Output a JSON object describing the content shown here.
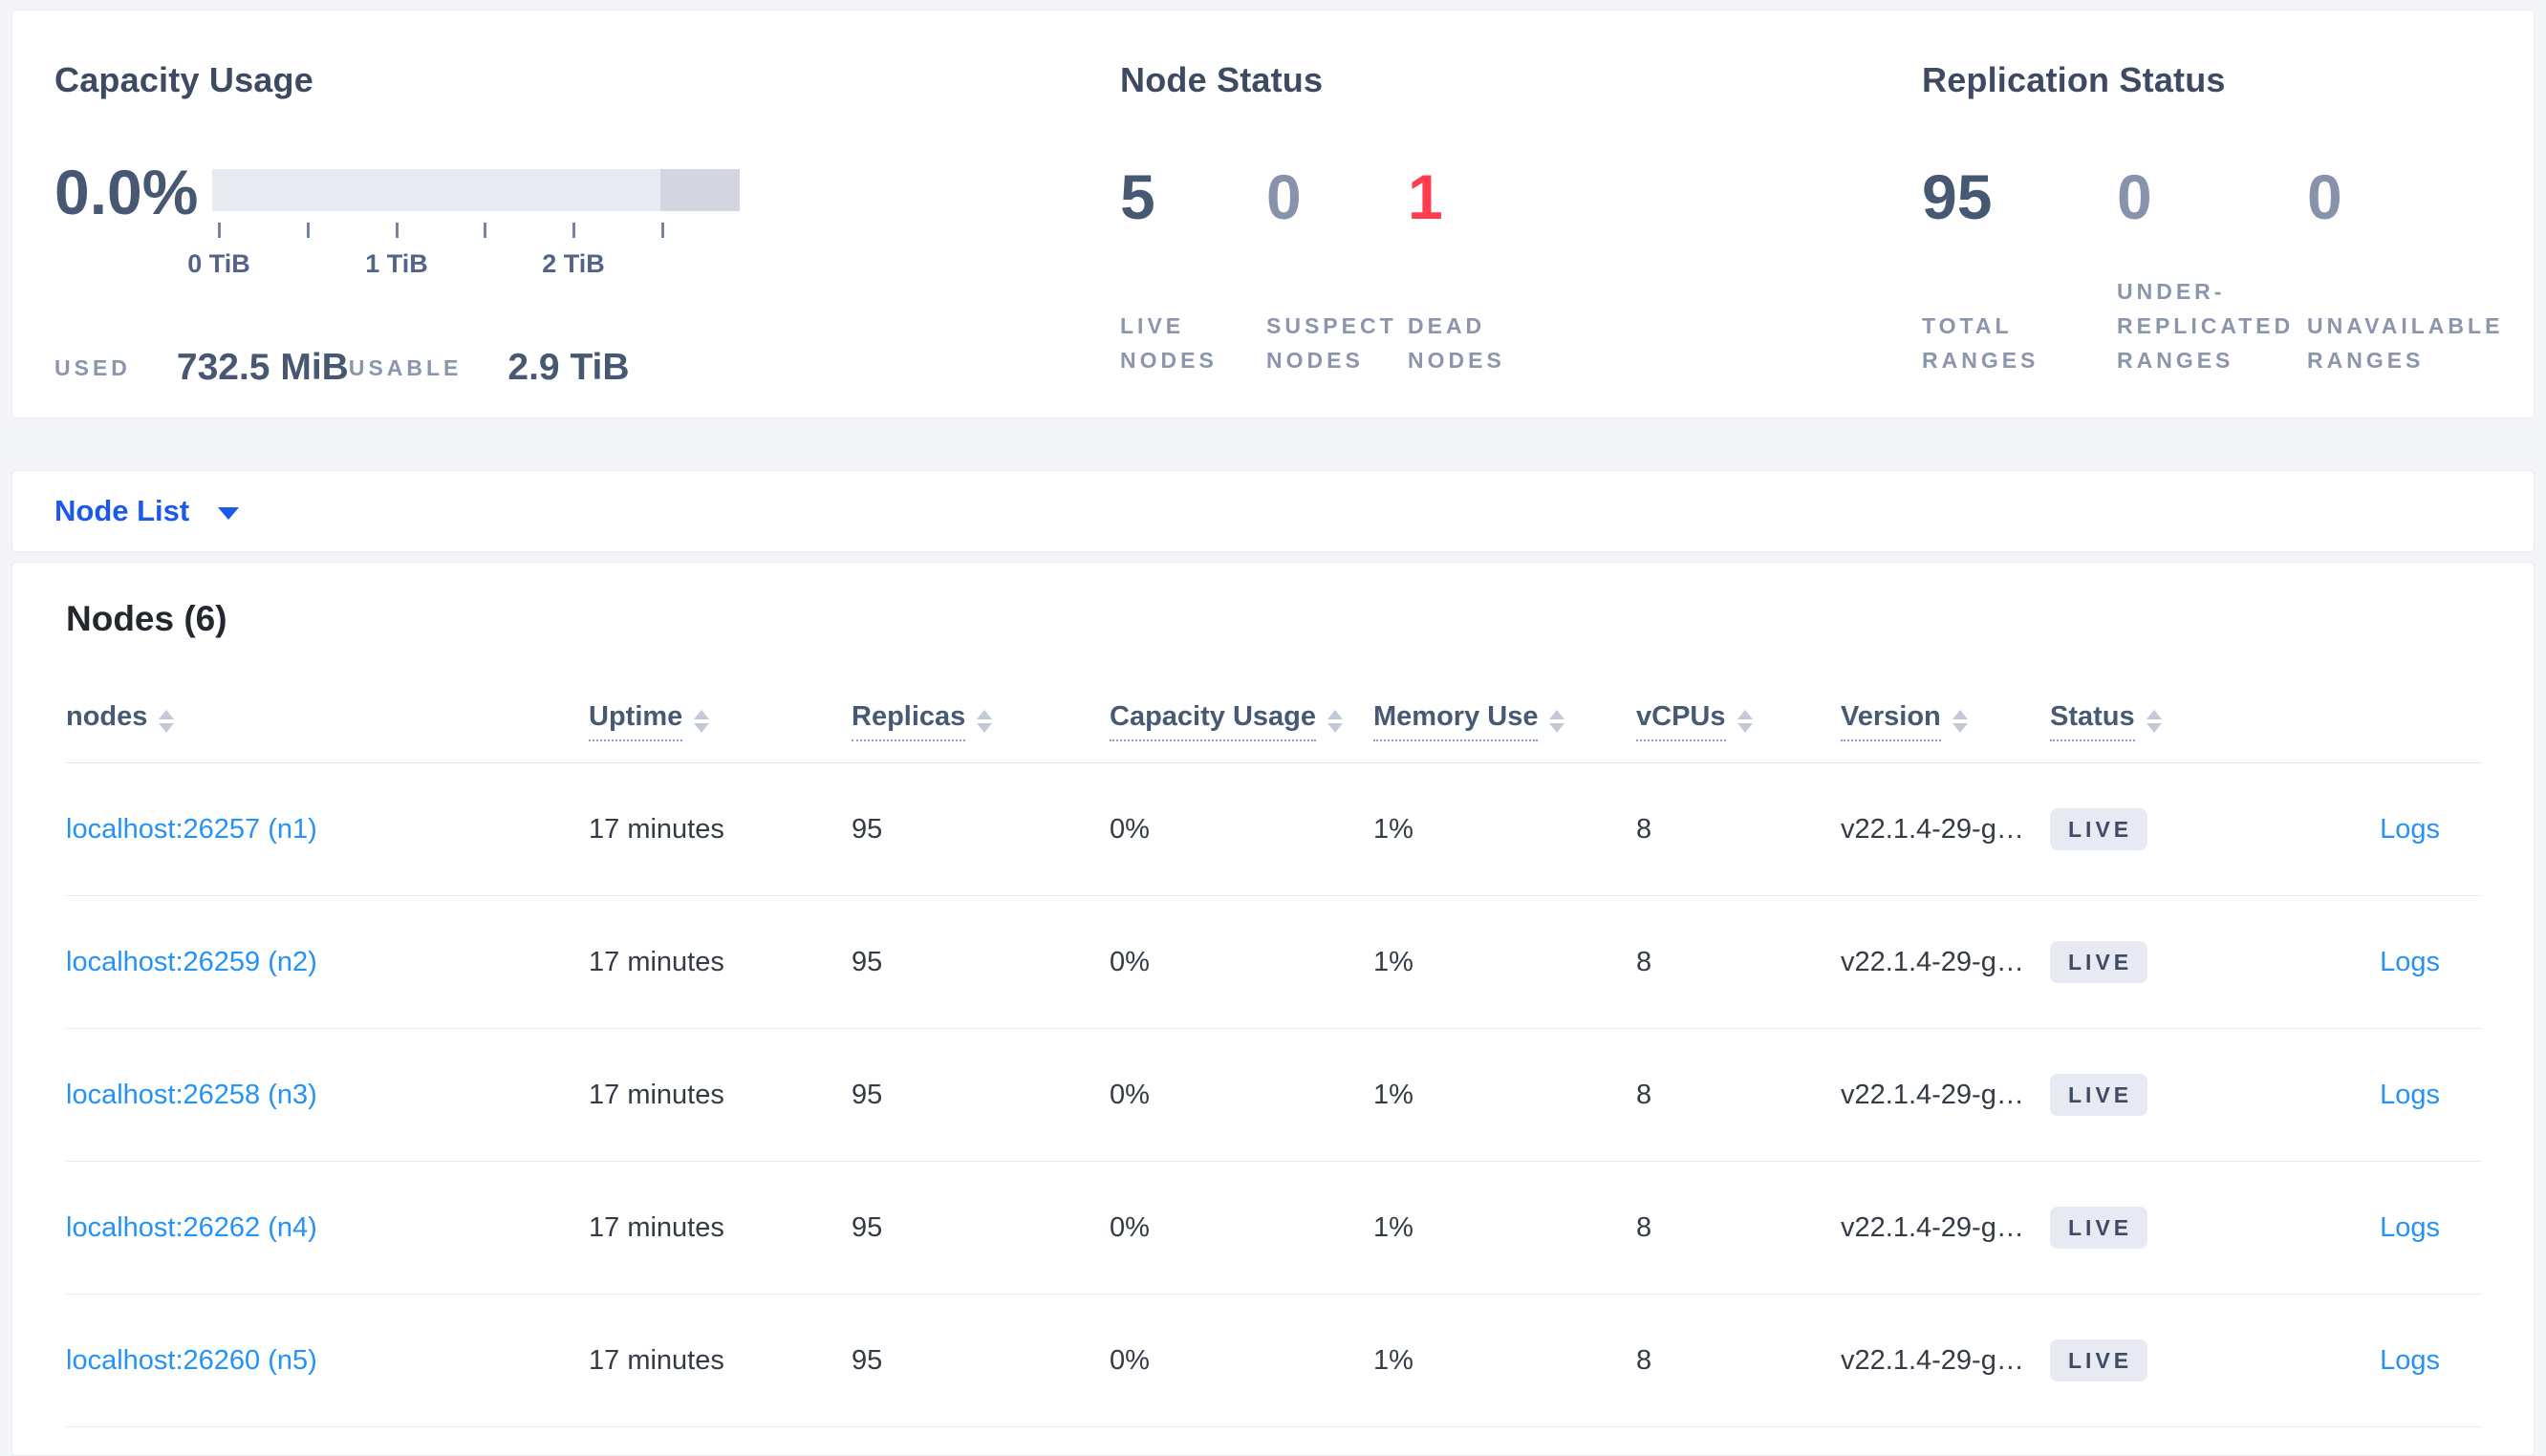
{
  "overview_card": {
    "capacity": {
      "title": "Capacity Usage",
      "percent": "0.0%",
      "bar": {
        "track_color": "#e8eaf1",
        "end_segment_color": "#d3d6e1",
        "end_segment_pct": 15
      },
      "tick_labels": [
        "0 TiB",
        "1 TiB",
        "2 TiB"
      ],
      "used_label": "USED",
      "used_value": "732.5 MiB",
      "usable_label": "USABLE",
      "usable_value": "2.9 TiB"
    },
    "node_status": {
      "title": "Node Status",
      "metrics": [
        {
          "value": "5",
          "label": "LIVE NODES",
          "value_color": "#475872"
        },
        {
          "value": "0",
          "label": "SUSPECT NODES",
          "value_color": "#8792ad"
        },
        {
          "value": "1",
          "label": "DEAD NODES",
          "value_color": "#ff3b4e"
        }
      ]
    },
    "replication_status": {
      "title": "Replication Status",
      "metrics": [
        {
          "value": "95",
          "label": "TOTAL RANGES",
          "value_color": "#475872"
        },
        {
          "value": "0",
          "label": "UNDER-REPLICATED RANGES",
          "value_color": "#8792ad"
        },
        {
          "value": "0",
          "label": "UNAVAILABLE RANGES",
          "value_color": "#8792ad"
        }
      ]
    }
  },
  "view_selector": {
    "label": "Node List"
  },
  "nodes_section": {
    "title": "Nodes (6)",
    "columns": [
      {
        "label": "nodes"
      },
      {
        "label": "Uptime"
      },
      {
        "label": "Replicas"
      },
      {
        "label": "Capacity Usage"
      },
      {
        "label": "Memory Use"
      },
      {
        "label": "vCPUs"
      },
      {
        "label": "Version"
      },
      {
        "label": "Status"
      }
    ],
    "rows": [
      {
        "node": "localhost:26257 (n1)",
        "uptime": "17 minutes",
        "replicas": "95",
        "capacity": "0%",
        "memory": "1%",
        "vcpus": "8",
        "version": "v22.1.4-29-g…",
        "status": "LIVE",
        "logs": "Logs"
      },
      {
        "node": "localhost:26259 (n2)",
        "uptime": "17 minutes",
        "replicas": "95",
        "capacity": "0%",
        "memory": "1%",
        "vcpus": "8",
        "version": "v22.1.4-29-g…",
        "status": "LIVE",
        "logs": "Logs"
      },
      {
        "node": "localhost:26258 (n3)",
        "uptime": "17 minutes",
        "replicas": "95",
        "capacity": "0%",
        "memory": "1%",
        "vcpus": "8",
        "version": "v22.1.4-29-g…",
        "status": "LIVE",
        "logs": "Logs"
      },
      {
        "node": "localhost:26262 (n4)",
        "uptime": "17 minutes",
        "replicas": "95",
        "capacity": "0%",
        "memory": "1%",
        "vcpus": "8",
        "version": "v22.1.4-29-g…",
        "status": "LIVE",
        "logs": "Logs"
      },
      {
        "node": "localhost:26260 (n5)",
        "uptime": "17 minutes",
        "replicas": "95",
        "capacity": "0%",
        "memory": "1%",
        "vcpus": "8",
        "version": "v22.1.4-29-g…",
        "status": "LIVE",
        "logs": "Logs"
      }
    ]
  }
}
